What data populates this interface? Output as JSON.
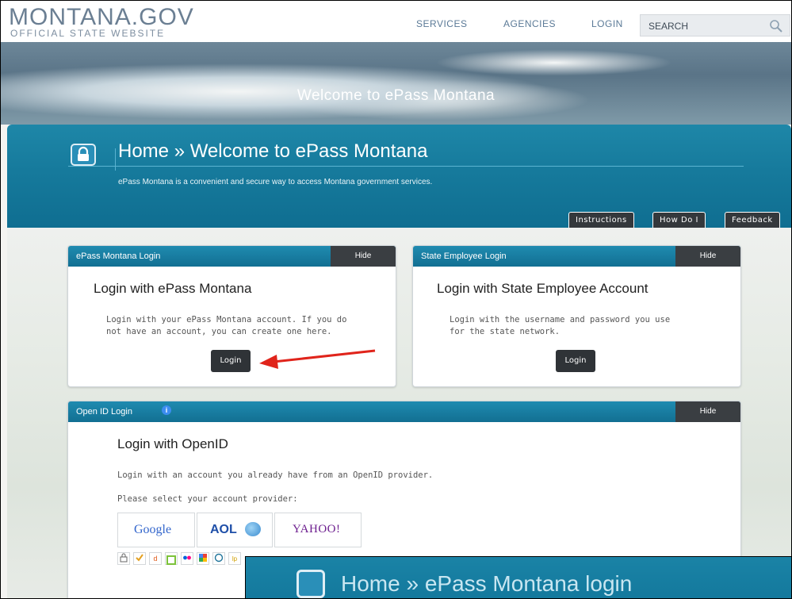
{
  "header": {
    "logo_main": "MONTANA.GOV",
    "logo_sub": "OFFICIAL STATE WEBSITE",
    "nav": [
      "SERVICES",
      "AGENCIES",
      "LOGIN"
    ],
    "search_label": "SEARCH"
  },
  "hero": {
    "title": "Welcome to ePass Montana"
  },
  "banner": {
    "title": "Home » Welcome to ePass Montana",
    "tagline": "ePass Montana is a convenient and secure way to access Montana government services.",
    "buttons": [
      "Instructions",
      "How Do I",
      "Feedback"
    ]
  },
  "epass_panel": {
    "header": "ePass Montana Login",
    "hide": "Hide",
    "heading": "Login with ePass Montana",
    "text_line1": "Login with your ePass Montana account. If you do",
    "text_line2": "not have an account, you can create one here.",
    "button": "Login"
  },
  "state_panel": {
    "header": "State Employee Login",
    "hide": "Hide",
    "heading": "Login with State Employee Account",
    "text_line1": "Login with the username and password you use",
    "text_line2": "for the state network.",
    "button": "Login"
  },
  "openid_panel": {
    "header": "Open ID Login",
    "hide": "Hide",
    "heading": "Login with OpenID",
    "text": "Login with an account you already have from an OpenID provider.",
    "select_label": "Please select your account provider:",
    "providers": [
      "Google",
      "AOL",
      "YAHOO!"
    ],
    "small_providers": [
      "openid",
      "verisign",
      "claimid",
      "clickpass",
      "flickr",
      "google-profile",
      "wordpress",
      "launchpad"
    ]
  },
  "overlay": {
    "title": "Home » ePass Montana login"
  }
}
